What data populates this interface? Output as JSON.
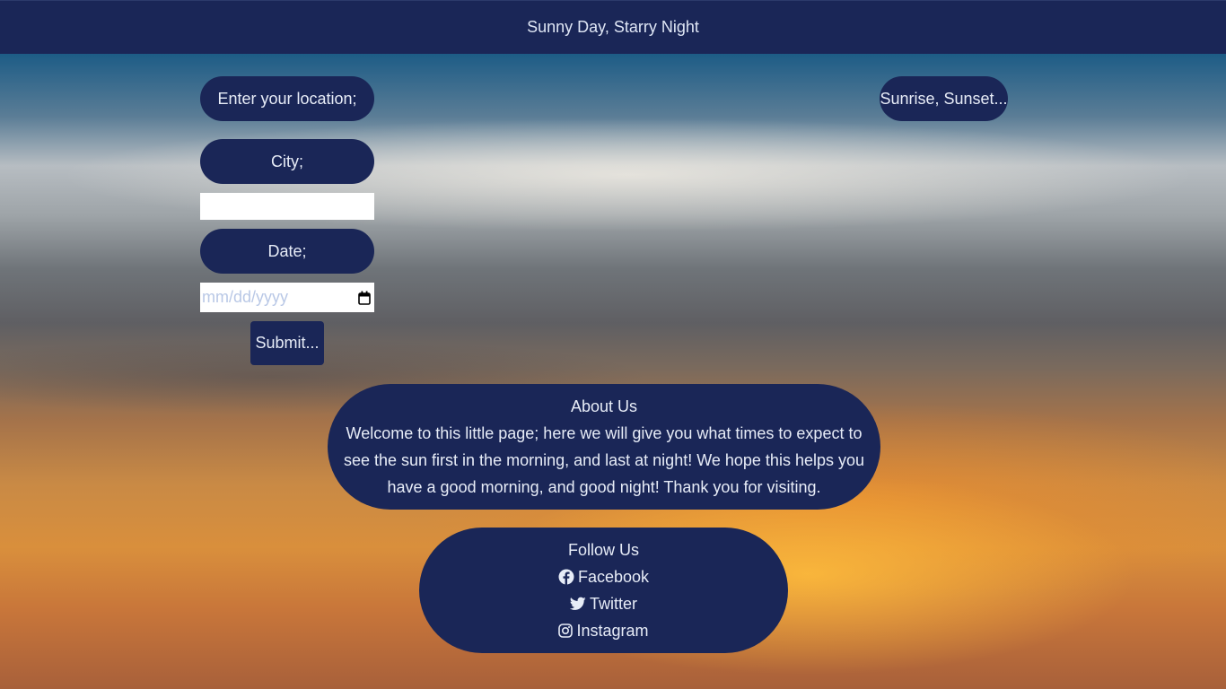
{
  "header": {
    "title": "Sunny Day, Starry Night"
  },
  "form": {
    "location_label": "Enter your location;",
    "city_label": "City;",
    "city_value": "",
    "date_label": "Date;",
    "date_placeholder": "mm/dd/yyyy",
    "submit_label": "Submit..."
  },
  "results": {
    "label": "Sunrise, Sunset..."
  },
  "about": {
    "heading": "About Us",
    "body": "Welcome to this little page; here we will give you what times to expect to see the sun first in the morning, and last at night! We hope this helps you have a good morning, and good night! Thank you for visiting."
  },
  "follow": {
    "heading": "Follow Us",
    "links": [
      {
        "label": "Facebook",
        "icon": "facebook-icon"
      },
      {
        "label": "Twitter",
        "icon": "twitter-icon"
      },
      {
        "label": "Instagram",
        "icon": "instagram-icon"
      }
    ]
  },
  "colors": {
    "panel": "#1a2657",
    "text": "#e7ecf7",
    "placeholder": "#b9c8e6"
  }
}
